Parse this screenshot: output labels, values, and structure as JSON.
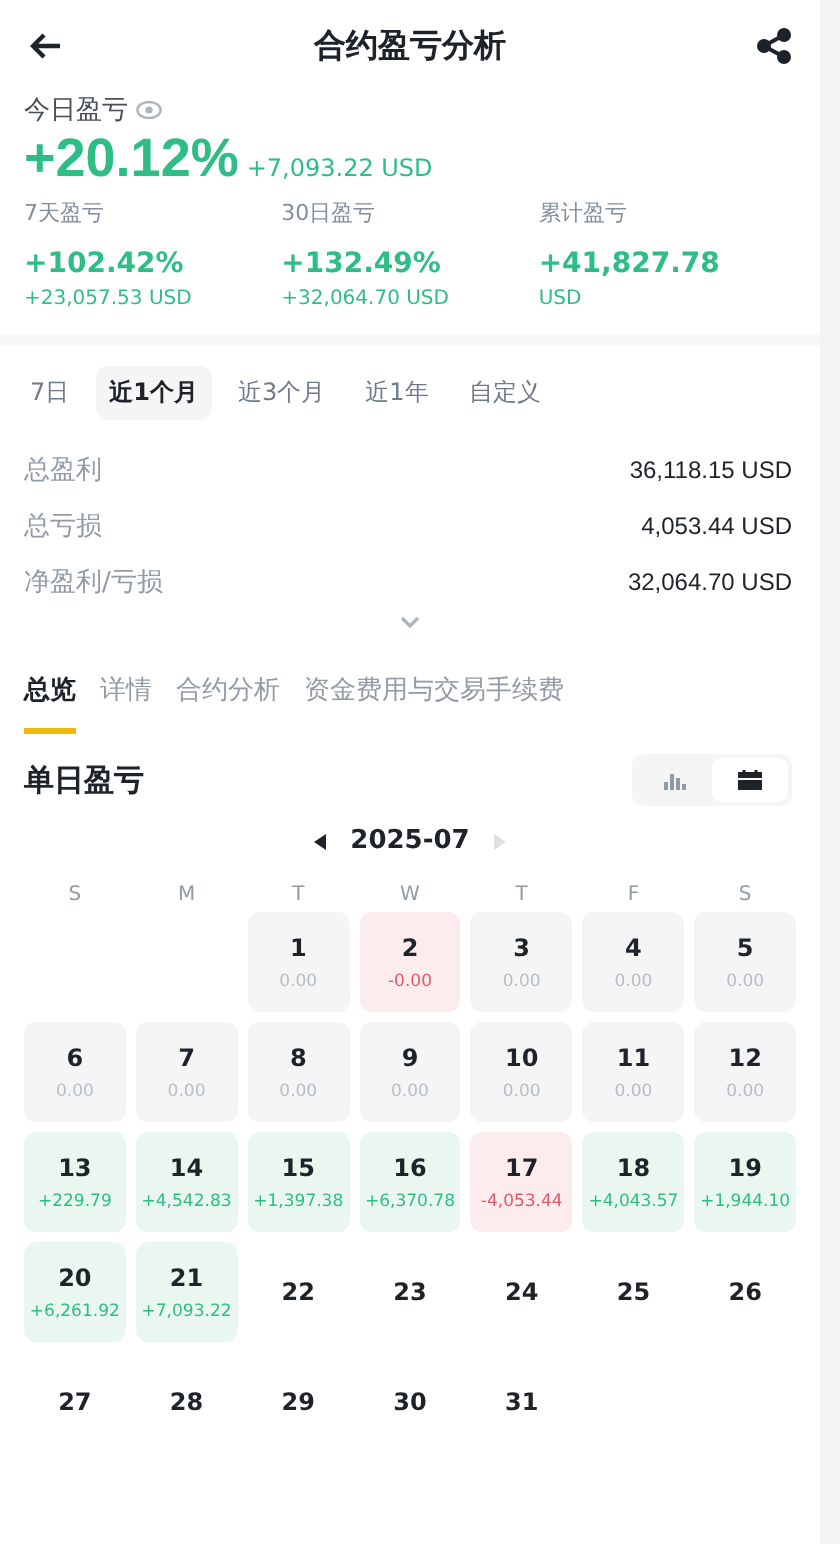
{
  "header": {
    "title": "合约盈亏分析"
  },
  "today": {
    "label": "今日盈亏",
    "percent": "+20.12%",
    "amount": "+7,093.22 USD"
  },
  "periods": [
    {
      "label": "7天盈亏",
      "percent": "+102.42%",
      "amount": "+23,057.53 USD"
    },
    {
      "label": "30日盈亏",
      "percent": "+132.49%",
      "amount": "+32,064.70 USD"
    },
    {
      "label": "累计盈亏",
      "percent": "+41,827.78",
      "amount": "USD"
    }
  ],
  "ranges": [
    {
      "label": "7日",
      "selected": false
    },
    {
      "label": "近1个月",
      "selected": true
    },
    {
      "label": "近3个月",
      "selected": false
    },
    {
      "label": "近1年",
      "selected": false
    },
    {
      "label": "自定义",
      "selected": false
    }
  ],
  "stats": [
    {
      "label": "总盈利",
      "value": "36,118.15 USD"
    },
    {
      "label": "总亏损",
      "value": "4,053.44 USD"
    },
    {
      "label": "净盈利/亏损",
      "value": "32,064.70 USD"
    }
  ],
  "tabs": [
    {
      "label": "总览",
      "selected": true
    },
    {
      "label": "详情",
      "selected": false
    },
    {
      "label": "合约分析",
      "selected": false
    },
    {
      "label": "资金费用与交易手续费",
      "selected": false
    }
  ],
  "daily": {
    "title": "单日盈亏",
    "views": [
      {
        "kind": "bars",
        "selected": false
      },
      {
        "kind": "calendar",
        "selected": true
      }
    ],
    "month": "2025-07",
    "weekdays": [
      "S",
      "M",
      "T",
      "W",
      "T",
      "F",
      "S"
    ],
    "days": [
      {
        "kind": "empty"
      },
      {
        "kind": "empty"
      },
      {
        "kind": "flat",
        "day": "1",
        "value": "0.00"
      },
      {
        "kind": "loss",
        "day": "2",
        "value": "-0.00"
      },
      {
        "kind": "flat",
        "day": "3",
        "value": "0.00"
      },
      {
        "kind": "flat",
        "day": "4",
        "value": "0.00"
      },
      {
        "kind": "flat",
        "day": "5",
        "value": "0.00"
      },
      {
        "kind": "flat",
        "day": "6",
        "value": "0.00"
      },
      {
        "kind": "flat",
        "day": "7",
        "value": "0.00"
      },
      {
        "kind": "flat",
        "day": "8",
        "value": "0.00"
      },
      {
        "kind": "flat",
        "day": "9",
        "value": "0.00"
      },
      {
        "kind": "flat",
        "day": "10",
        "value": "0.00"
      },
      {
        "kind": "flat",
        "day": "11",
        "value": "0.00"
      },
      {
        "kind": "flat",
        "day": "12",
        "value": "0.00"
      },
      {
        "kind": "profit",
        "day": "13",
        "value": "+229.79"
      },
      {
        "kind": "profit",
        "day": "14",
        "value": "+4,542.83"
      },
      {
        "kind": "profit",
        "day": "15",
        "value": "+1,397.38"
      },
      {
        "kind": "profit",
        "day": "16",
        "value": "+6,370.78"
      },
      {
        "kind": "loss",
        "day": "17",
        "value": "-4,053.44"
      },
      {
        "kind": "profit",
        "day": "18",
        "value": "+4,043.57"
      },
      {
        "kind": "profit",
        "day": "19",
        "value": "+1,944.10"
      },
      {
        "kind": "profit",
        "day": "20",
        "value": "+6,261.92"
      },
      {
        "kind": "profit",
        "day": "21",
        "value": "+7,093.22"
      },
      {
        "kind": "future",
        "day": "22"
      },
      {
        "kind": "future",
        "day": "23"
      },
      {
        "kind": "future",
        "day": "24"
      },
      {
        "kind": "future",
        "day": "25"
      },
      {
        "kind": "future",
        "day": "26"
      },
      {
        "kind": "future",
        "day": "27"
      },
      {
        "kind": "future",
        "day": "28"
      },
      {
        "kind": "future",
        "day": "29"
      },
      {
        "kind": "future",
        "day": "30"
      },
      {
        "kind": "future",
        "day": "31"
      }
    ]
  }
}
